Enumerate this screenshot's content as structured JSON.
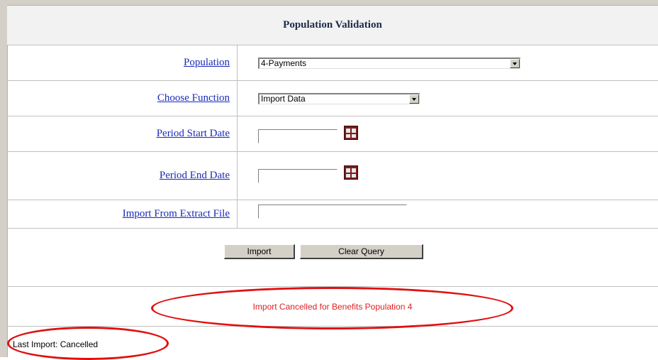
{
  "title": "Population Validation",
  "fields": {
    "population": {
      "label": "Population",
      "value": "4-Payments"
    },
    "function": {
      "label": "Choose Function",
      "value": "Import Data"
    },
    "period_start": {
      "label": "Period Start Date",
      "value": ""
    },
    "period_end": {
      "label": "Period End Date",
      "value": ""
    },
    "import_file": {
      "label": "Import From Extract File",
      "value": ""
    }
  },
  "buttons": {
    "import": "Import",
    "clear": "Clear Query"
  },
  "message": "Import Cancelled for Benefits Population 4",
  "last_import": "Last Import: Cancelled",
  "colors": {
    "link": "#1a2bb8",
    "message": "#e02020",
    "highlight_ellipse": "#e01010"
  }
}
